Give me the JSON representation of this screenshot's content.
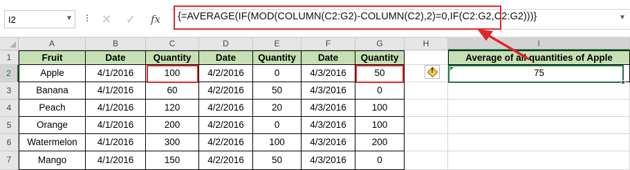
{
  "formula_bar": {
    "name_box": "I2",
    "cancel_symbol": "✕",
    "enter_symbol": "✓",
    "fx_label": "fx",
    "formula": "{=AVERAGE(IF(MOD(COLUMN(C2:G2)-COLUMN(C2),2)=0,IF(C2:G2,C2:G2)))}"
  },
  "columns": [
    "A",
    "B",
    "C",
    "D",
    "E",
    "F",
    "G",
    "H",
    "I"
  ],
  "rows": [
    "1",
    "2",
    "3",
    "4",
    "5",
    "6",
    "7"
  ],
  "table": {
    "headers": [
      "Fruit",
      "Date",
      "Quantity",
      "Date",
      "Quantity",
      "Date",
      "Quantity"
    ],
    "rows": [
      [
        "Apple",
        "4/1/2016",
        "100",
        "4/2/2016",
        "0",
        "4/3/2016",
        "50"
      ],
      [
        "Banana",
        "4/1/2016",
        "60",
        "4/2/2016",
        "50",
        "4/3/2016",
        "0"
      ],
      [
        "Peach",
        "4/1/2016",
        "120",
        "4/2/2016",
        "20",
        "4/3/2016",
        "100"
      ],
      [
        "Orange",
        "4/1/2016",
        "200",
        "4/2/2016",
        "0",
        "4/3/2016",
        "100"
      ],
      [
        "Watermelon",
        "4/1/2016",
        "300",
        "4/2/2016",
        "100",
        "4/3/2016",
        "200"
      ],
      [
        "Mango",
        "4/1/2016",
        "150",
        "4/2/2016",
        "50",
        "4/3/2016",
        "0"
      ]
    ]
  },
  "result": {
    "header": "Average of all quantities of Apple",
    "value": "75"
  },
  "colors": {
    "header_fill": "#c6e0b4",
    "highlight_red": "#e2252a",
    "excel_green": "#217346"
  },
  "icons": {
    "error_check": "warning-diamond-icon",
    "annotation": "red-arrow-icon"
  }
}
